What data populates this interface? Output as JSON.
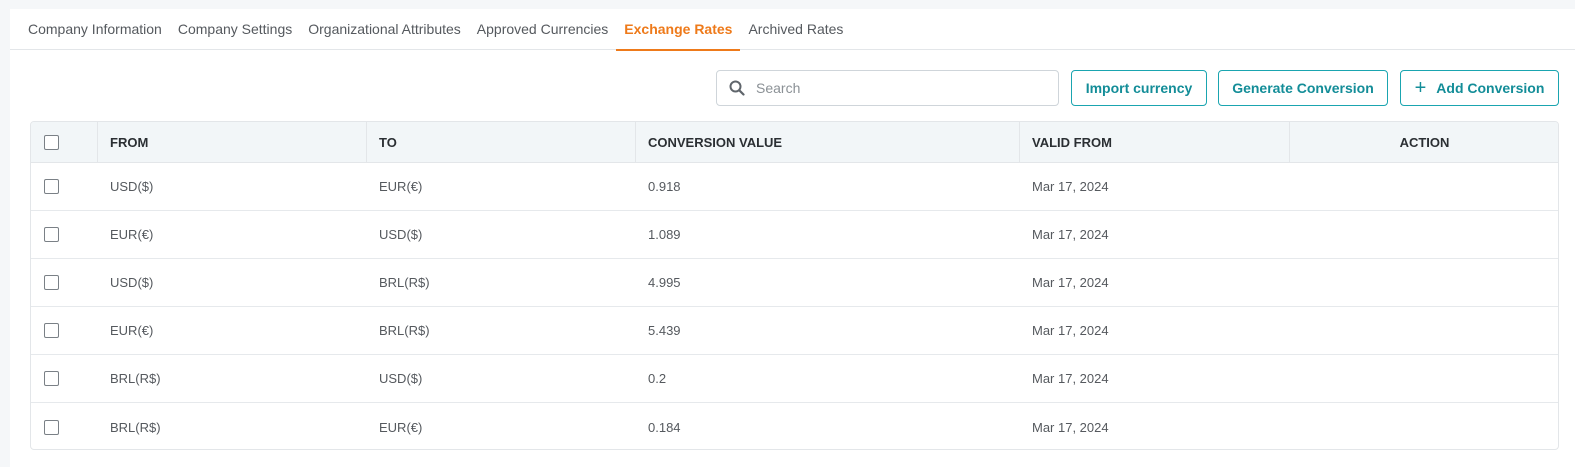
{
  "tabs": [
    {
      "label": "Company Information",
      "active": false
    },
    {
      "label": "Company Settings",
      "active": false
    },
    {
      "label": "Organizational Attributes",
      "active": false
    },
    {
      "label": "Approved Currencies",
      "active": false
    },
    {
      "label": "Exchange Rates",
      "active": true
    },
    {
      "label": "Archived Rates",
      "active": false
    }
  ],
  "toolbar": {
    "search_placeholder": "Search",
    "import_label": "Import currency",
    "generate_label": "Generate Conversion",
    "add_label": "Add Conversion"
  },
  "table": {
    "headers": {
      "from": "FROM",
      "to": "TO",
      "value": "CONVERSION VALUE",
      "valid_from": "VALID FROM",
      "action": "ACTION"
    },
    "rows": [
      {
        "from": "USD($)",
        "to": "EUR(€)",
        "value": "0.918",
        "valid_from": "Mar 17, 2024"
      },
      {
        "from": "EUR(€)",
        "to": "USD($)",
        "value": "1.089",
        "valid_from": "Mar 17, 2024"
      },
      {
        "from": "USD($)",
        "to": "BRL(R$)",
        "value": "4.995",
        "valid_from": "Mar 17, 2024"
      },
      {
        "from": "EUR(€)",
        "to": "BRL(R$)",
        "value": "5.439",
        "valid_from": "Mar 17, 2024"
      },
      {
        "from": "BRL(R$)",
        "to": "USD($)",
        "value": "0.2",
        "valid_from": "Mar 17, 2024"
      },
      {
        "from": "BRL(R$)",
        "to": "EUR(€)",
        "value": "0.184",
        "valid_from": "Mar 17, 2024"
      }
    ]
  },
  "colors": {
    "accent_active_tab": "#ee7a1a",
    "button_teal": "#1aa5b0"
  }
}
